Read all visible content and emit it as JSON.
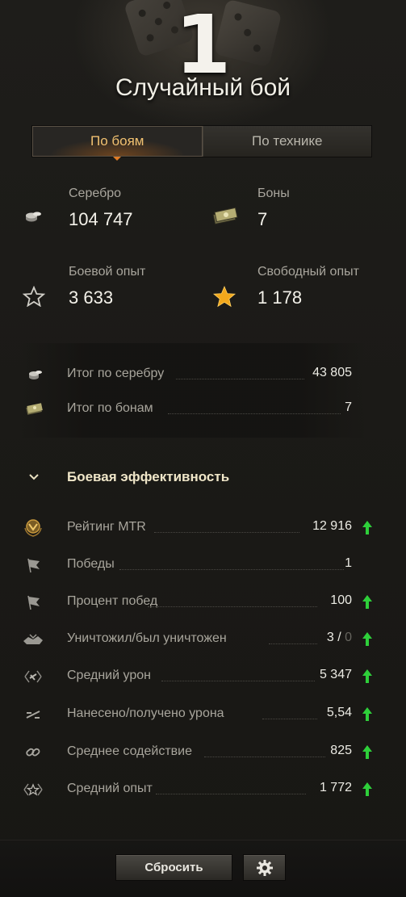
{
  "header": {
    "rank": "1",
    "title": "Случайный бой"
  },
  "tabs": [
    {
      "label": "По боям",
      "active": true
    },
    {
      "label": "По технике",
      "active": false
    }
  ],
  "earnings": {
    "credits": {
      "label": "Серебро",
      "value": "104 747",
      "icon": "credits-icon"
    },
    "bonds": {
      "label": "Боны",
      "value": "7",
      "icon": "bonds-icon"
    },
    "battle_xp": {
      "label": "Боевой опыт",
      "value": "3 633",
      "icon": "star-outline-icon"
    },
    "free_xp": {
      "label": "Свободный опыт",
      "value": "1 178",
      "icon": "star-gold-icon"
    }
  },
  "totals": [
    {
      "label": "Итог по серебру",
      "value": "43 805",
      "icon": "credits-icon"
    },
    {
      "label": "Итог по бонам",
      "value": "7",
      "icon": "bonds-icon"
    }
  ],
  "section": {
    "title": "Боевая эффективность",
    "icon": "chevron-down-icon"
  },
  "stats": [
    {
      "label": "Рейтинг MTR",
      "value": "12 916",
      "icon": "mtr-rating-icon",
      "trend": "up"
    },
    {
      "label": "Победы",
      "value": "1",
      "icon": "flag-icon",
      "trend": "none"
    },
    {
      "label": "Процент побед",
      "value": "100",
      "icon": "flag-icon",
      "trend": "up"
    },
    {
      "label": "Уничтожил/был уничтожен",
      "value": "3",
      "value_secondary": "0",
      "icon": "destroyed-tank-icon",
      "trend": "up"
    },
    {
      "label": "Средний урон",
      "value": "5 347",
      "icon": "damage-icon",
      "trend": "up"
    },
    {
      "label": "Нанесено/получено урона",
      "value": "5,54",
      "icon": "damage-ratio-icon",
      "trend": "up"
    },
    {
      "label": "Среднее содействие",
      "value": "825",
      "icon": "assist-link-icon",
      "trend": "up"
    },
    {
      "label": "Средний опыт",
      "value": "1 772",
      "icon": "xp-star-icon",
      "trend": "up"
    }
  ],
  "footer": {
    "reset_label": "Сбросить",
    "settings_icon": "gear-icon"
  },
  "colors": {
    "accent": "#f0c070",
    "trend_up": "#2ecf3a",
    "gold_star": "#f2a81c"
  }
}
